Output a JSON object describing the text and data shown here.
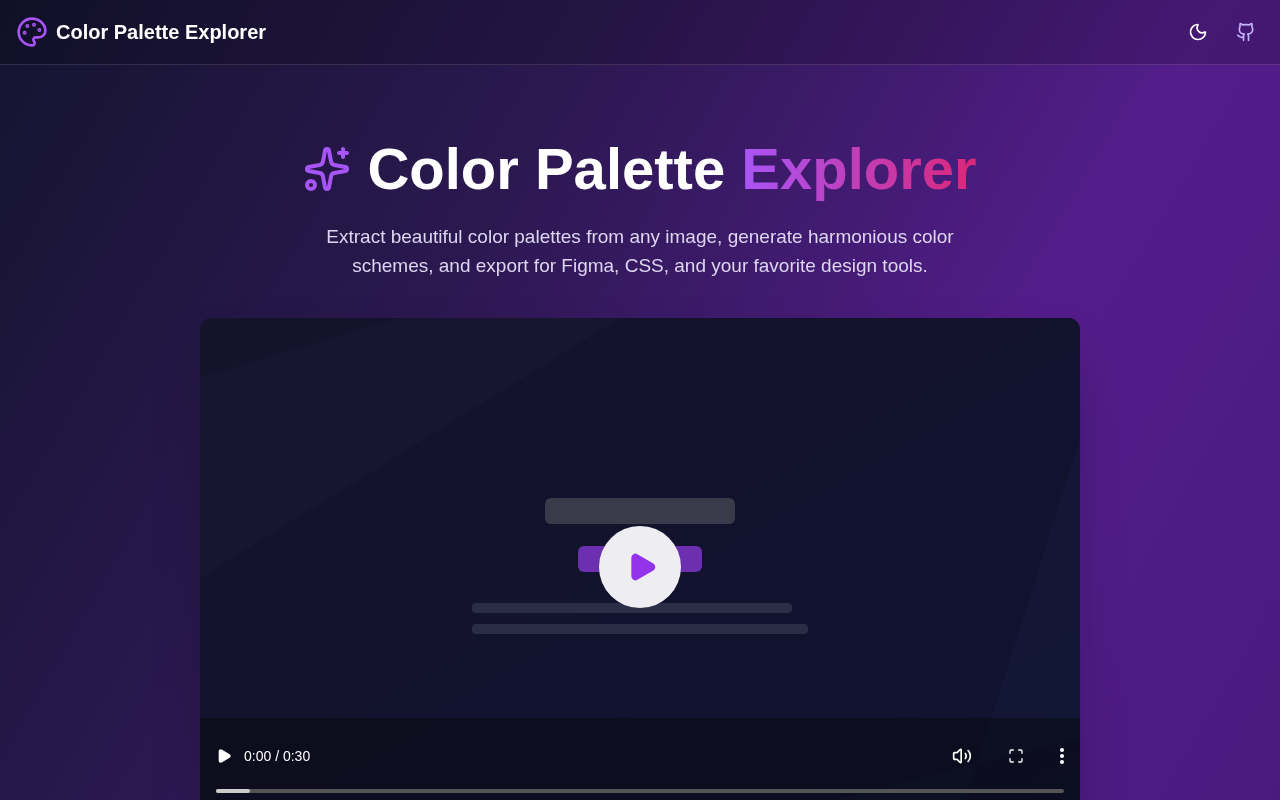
{
  "header": {
    "title": "Color Palette Explorer"
  },
  "hero": {
    "title_main": "Color Palette",
    "title_accent": "Explorer",
    "subtitle": "Extract beautiful color palettes from any image, generate harmonious color schemes, and export for Figma, CSS, and your favorite design tools."
  },
  "video": {
    "time": "0:00 / 0:30",
    "progress": {
      "level": 0.04
    }
  }
}
